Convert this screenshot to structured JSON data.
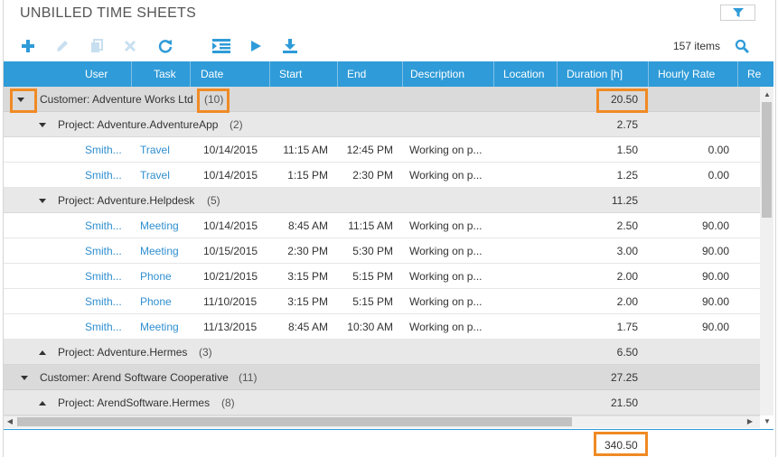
{
  "panel": {
    "title": "UNBILLED TIME SHEETS"
  },
  "toolbar": {
    "icons": [
      "plus-icon",
      "pencil-icon",
      "copy-icon",
      "close-icon",
      "refresh-icon",
      "indent-icon",
      "play-icon",
      "download-icon"
    ],
    "items_count": "157 items"
  },
  "columns": [
    "User",
    "Task",
    "Date",
    "Start",
    "End",
    "Description",
    "Location",
    "Duration [h]",
    "Hourly Rate",
    "Re"
  ],
  "rows": [
    {
      "kind": "customer",
      "label": "Customer: Adventure Works Ltd",
      "count": "(10)",
      "duration": "20.50"
    },
    {
      "kind": "project",
      "label": "Project: Adventure.AdventureApp",
      "count": "(2)",
      "duration": "2.75"
    },
    {
      "kind": "data",
      "user": "Smith...",
      "task": "Travel",
      "date": "10/14/2015",
      "start": "11:15 AM",
      "end": "12:45 PM",
      "description": "Working on p...",
      "duration": "1.50",
      "rate": "0.00"
    },
    {
      "kind": "data",
      "user": "Smith...",
      "task": "Travel",
      "date": "10/14/2015",
      "start": "1:15 PM",
      "end": "2:30 PM",
      "description": "Working on p...",
      "duration": "1.25",
      "rate": "0.00"
    },
    {
      "kind": "project",
      "label": "Project: Adventure.Helpdesk",
      "count": "(5)",
      "duration": "11.25"
    },
    {
      "kind": "data",
      "user": "Smith...",
      "task": "Meeting",
      "date": "10/14/2015",
      "start": "8:45 AM",
      "end": "11:15 AM",
      "description": "Working on p...",
      "duration": "2.50",
      "rate": "90.00"
    },
    {
      "kind": "data",
      "user": "Smith...",
      "task": "Meeting",
      "date": "10/15/2015",
      "start": "2:30 PM",
      "end": "5:30 PM",
      "description": "Working on p...",
      "duration": "3.00",
      "rate": "90.00"
    },
    {
      "kind": "data",
      "user": "Smith...",
      "task": "Phone",
      "date": "10/21/2015",
      "start": "3:15 PM",
      "end": "5:15 PM",
      "description": "Working on p...",
      "duration": "2.00",
      "rate": "90.00"
    },
    {
      "kind": "data",
      "user": "Smith...",
      "task": "Phone",
      "date": "11/10/2015",
      "start": "3:15 PM",
      "end": "5:15 PM",
      "description": "Working on p...",
      "duration": "2.00",
      "rate": "90.00"
    },
    {
      "kind": "data",
      "user": "Smith...",
      "task": "Meeting",
      "date": "11/13/2015",
      "start": "8:45 AM",
      "end": "10:30 AM",
      "description": "Working on p...",
      "duration": "1.75",
      "rate": "90.00"
    },
    {
      "kind": "project-collapsed",
      "label": "Project: Adventure.Hermes",
      "count": "(3)",
      "duration": "6.50"
    },
    {
      "kind": "customer",
      "label": "Customer: Arend Software Cooperative",
      "count": "(11)",
      "duration": "27.25"
    },
    {
      "kind": "project-collapsed",
      "label": "Project: ArendSoftware.Hermes",
      "count": "(8)",
      "duration": "21.50"
    }
  ],
  "footer": {
    "total_duration": "340.50"
  },
  "colors": {
    "accent": "#2f9bd8",
    "highlight": "#f08a24",
    "link": "#2f8fd0"
  }
}
